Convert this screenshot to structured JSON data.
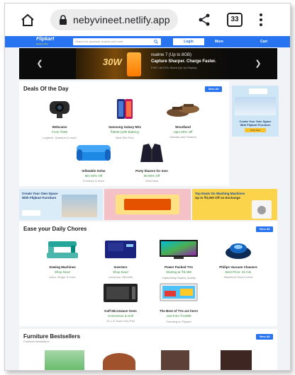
{
  "browser": {
    "url": "nebyvineet.netlify.app",
    "tabs_count": "33"
  },
  "header": {
    "logo": "Flipkart",
    "logo_sub": "Explore Plus",
    "search_placeholder": "Search for products, brands and more",
    "login_label": "Login",
    "more_label": "More",
    "cart_label": "Cart"
  },
  "banner": {
    "promo_big": "30W",
    "line1": "realme 7 (Up to 8GB)",
    "line2": "Capture Sharper. Charge Faster.",
    "line3": "FHD+ AnTuTu Score (Up to) Display"
  },
  "deals": {
    "title": "Deals Of the Day",
    "view_all": "View All",
    "items": [
      {
        "name": "Webcams",
        "price": "From ₹299",
        "sub": "Logitech, Quantum & more"
      },
      {
        "name": "Samsung Galaxy M11",
        "price": "₹8639 (with Battery)",
        "sub": "Best EMI Plan"
      },
      {
        "name": "Woodland",
        "price": "Upto 50% Off",
        "sub": "Sandals and Floaters"
      },
      {
        "name": "Inflatable Sofas",
        "price": "Min 50% Off",
        "sub": "Furniture & more"
      },
      {
        "name": "Party blazers for men",
        "price": "50-80% Off",
        "sub": "Grab Now"
      }
    ]
  },
  "side_ad": {
    "text": "Create Your Own Space With Flipkart Furniture",
    "button": "Shop Now"
  },
  "promos": [
    {
      "line1": "Create Your Own Space",
      "line2": "With Flipkart Furniture"
    },
    {
      "line1": "",
      "line2": ""
    },
    {
      "line1": "Top Deals On Washing Machines",
      "line2": "Up to ₹3,000 Off on Exchange"
    }
  ],
  "chores": {
    "title": "Ease your Daily Chores",
    "view_all": "View All",
    "items": [
      {
        "name": "Sewing Machines",
        "price": "Shop Now!",
        "sub": "Usha, Singer & more"
      },
      {
        "name": "Inverters",
        "price": "Shop Now!",
        "sub": "Luminous, Microtek"
      },
      {
        "name": "Power Packed TVs",
        "price": "Starting at ₹8,499",
        "sub": "Captivating Display Quality"
      },
      {
        "name": "Philips Vacuum Cleaners",
        "price": "Best Price: 15 min",
        "sub": "Maximum Sound Level"
      },
      {
        "name": "Kaff Microwave Oven",
        "price": "Convection & Grill",
        "sub": "21 L & Touch Key Pad"
      },
      {
        "name": "The Best of TVs are here!",
        "price": "Just from ₹12999",
        "sub": "Trending on Flipkart"
      }
    ]
  },
  "furniture": {
    "title": "Furniture Bestsellers",
    "subtitle": "Furniture Bestsellers",
    "view_all": "View All"
  }
}
